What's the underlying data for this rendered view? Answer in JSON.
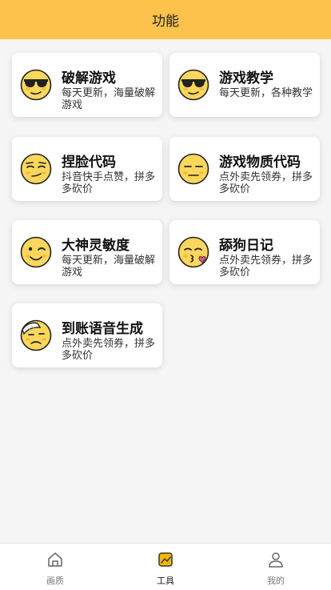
{
  "header": {
    "title": "功能"
  },
  "cards": [
    {
      "title": "破解游戏",
      "desc": "每天更新，海量破解游戏",
      "icon": "sunglasses-face-icon"
    },
    {
      "title": "游戏教学",
      "desc": "每天更新，各种教学",
      "icon": "sunglasses-face-icon"
    },
    {
      "title": "捏脸代码",
      "desc": "抖音快手点赞，拼多多砍价",
      "icon": "smirking-face-icon"
    },
    {
      "title": "游戏物质代码",
      "desc": "点外卖先领券，拼多多砍价",
      "icon": "expressionless-face-icon"
    },
    {
      "title": "大神灵敏度",
      "desc": "每天更新，海量破解游戏",
      "icon": "winking-face-icon"
    },
    {
      "title": "舔狗日记",
      "desc": "点外卖先领券，拼多多砍价",
      "icon": "kissing-face-icon"
    },
    {
      "title": "到账语音生成",
      "desc": "点外卖先领券，拼多多砍价",
      "icon": "bandaged-face-icon"
    }
  ],
  "tabbar": {
    "items": [
      {
        "label": "画质",
        "icon": "home-icon",
        "active": false
      },
      {
        "label": "工具",
        "icon": "tools-icon",
        "active": true
      },
      {
        "label": "我的",
        "icon": "user-icon",
        "active": false
      }
    ]
  },
  "colors": {
    "header": "#fcc24c",
    "face": "#fdd75c",
    "accent": "#f5b800"
  }
}
